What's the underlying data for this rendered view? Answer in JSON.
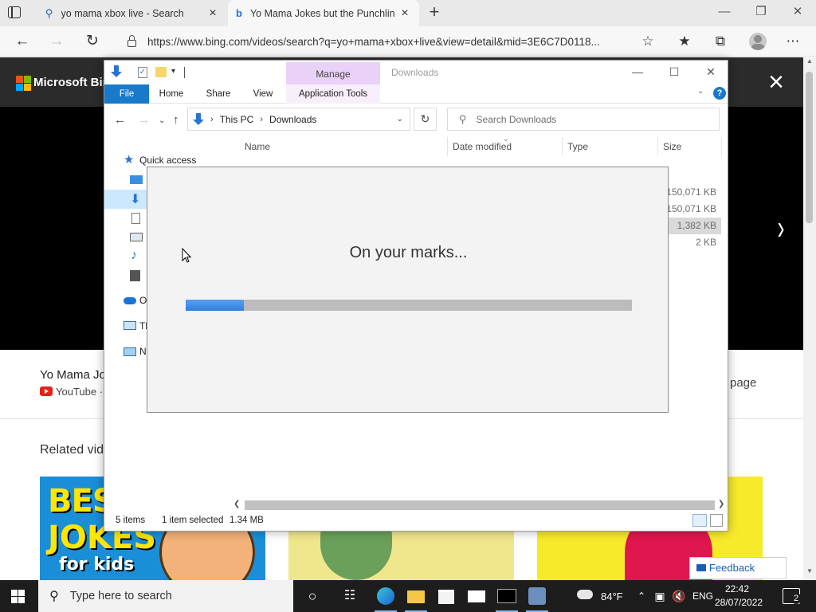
{
  "browser": {
    "tabs": [
      {
        "title": "yo mama xbox live - Search",
        "icon": "search-icon"
      },
      {
        "title": "Yo Mama Jokes but the Punchlin",
        "icon": "bing-icon"
      }
    ],
    "url": "https://www.bing.com/videos/search?q=yo+mama+xbox+live&view=detail&mid=3E6C7D0118..."
  },
  "bing": {
    "brand": "Microsoft Bing",
    "video_title": "Yo Mama Jo",
    "source": "YouTube ·",
    "page_link": "page",
    "related_title": "Related vide",
    "feedback": "Feedback",
    "thumb1": {
      "line1": "BES",
      "line2": "JOKES",
      "line3": "for kids"
    }
  },
  "explorer": {
    "ribbon_manage": "Manage",
    "window_title": "Downloads",
    "tabs": {
      "file": "File",
      "home": "Home",
      "share": "Share",
      "view": "View",
      "app_tools": "Application Tools"
    },
    "path": [
      "This PC",
      "Downloads"
    ],
    "search_placeholder": "Search Downloads",
    "columns": {
      "name": "Name",
      "date": "Date modified",
      "type": "Type",
      "size": "Size"
    },
    "nav": {
      "quick_access": "Quick access",
      "onedrive": "O",
      "this_pc": "Th",
      "network": "N"
    },
    "sizes": [
      "150,071 KB",
      "150,071 KB",
      "1,382 KB",
      "2 KB"
    ],
    "status": {
      "items": "5 items",
      "selected": "1 item selected",
      "size": "1.34 MB"
    }
  },
  "dialog": {
    "message": "On your marks...",
    "progress": 0.13
  },
  "taskbar": {
    "search_placeholder": "Type here to search",
    "weather": "84°F",
    "language": "ENG",
    "time": "22:42",
    "date": "28/07/2022",
    "notifications": "2"
  },
  "colors": {
    "accent": "#1979ca",
    "manage_tab": "#e9d1f7",
    "progress_fill": "#2f7fdc",
    "taskbar": "#1d1d1d"
  }
}
